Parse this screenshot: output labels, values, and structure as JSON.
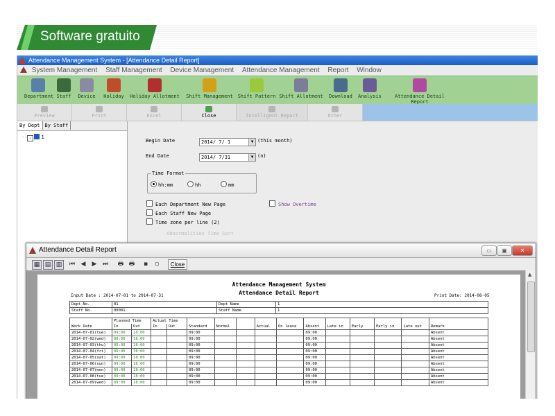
{
  "banner": {
    "label": "Software gratuito"
  },
  "window": {
    "title": "Attendance Management System - [Attendance Detail Report]"
  },
  "menu": [
    "System Management",
    "Staff Management",
    "Device Management",
    "Attendance Management",
    "Report",
    "Window"
  ],
  "toolbar": [
    "Department",
    "Staff",
    "Device",
    "Holiday",
    "Holiday Allotment",
    "Shift Management",
    "Shift Pattern",
    "Shift Allotment",
    "Download",
    "Analysis",
    "Attendance Detail Report"
  ],
  "subtoolbar": [
    "Preview",
    "Print",
    "Excel",
    "Close",
    "Intelligent Report",
    "Other"
  ],
  "left_tabs": [
    "By Dept",
    "By Staff"
  ],
  "tree": {
    "root": "1"
  },
  "form": {
    "begin_label": "Begin Date",
    "begin_value": "2014/ 7/ 1",
    "begin_note": "(this month)",
    "end_label": "End Date",
    "end_value": "2014/ 7/31",
    "end_note": "(n)",
    "time_format_legend": "Time Format",
    "opt1": "hh:mm",
    "opt2": "hh",
    "opt3": "mm",
    "check1": "Each Department New Page",
    "check2": "Each Staff New Page",
    "check3": "Time zone per line (2)",
    "show_overtime": "Show Overtime",
    "hidden_hint": "Abnormalities Time Sort"
  },
  "child": {
    "title": "Attendance Detail Report",
    "close": "Close"
  },
  "report": {
    "title1": "Attendance Management System",
    "title2": "Attendance Detail Report",
    "input_date": "Input Date : 2014-07-01 to 2014-07-31",
    "print_date": "Print Date: 2014-08-05",
    "dept_no_label": "Dept No.",
    "dept_no": "01",
    "dept_name_label": "Dept Name",
    "dept_name": "1",
    "staff_no_label": "Staff No.",
    "staff_no": "00001",
    "staff_name_label": "Staff Name",
    "staff_name": "1",
    "h_work_date": "Work Date",
    "h_planned": "Planned Time",
    "h_actual": "Actual Time",
    "h_in": "In",
    "h_out": "Out",
    "h_in2": "In",
    "h_out2": "Out",
    "h_standard": "Standard",
    "h_normal": "Normal",
    "h_actual2": "Actual",
    "h_onleave": "On leave",
    "h_absent": "Absent",
    "h_latein": "Late in",
    "h_early": "Early",
    "h_earlyin": "Early in",
    "h_lateout": "Late out",
    "h_remark": "Remark",
    "rows": [
      {
        "date": "2014-07-01(tue)",
        "in": "09:00",
        "out": "18:00",
        "std": "09:00",
        "abs": "09:00",
        "remark": "Absent"
      },
      {
        "date": "2014-07-02(wed)",
        "in": "09:00",
        "out": "18:00",
        "std": "09:00",
        "abs": "09:00",
        "remark": "Absent"
      },
      {
        "date": "2014-07-03(thu)",
        "in": "09:00",
        "out": "18:00",
        "std": "09:00",
        "abs": "09:00",
        "remark": "Absent"
      },
      {
        "date": "2014-07-04(fri)",
        "in": "09:00",
        "out": "18:00",
        "std": "09:00",
        "abs": "09:00",
        "remark": "Absent"
      },
      {
        "date": "2014-07-05(sat)",
        "in": "09:00",
        "out": "18:00",
        "std": "09:00",
        "abs": "09:00",
        "remark": "Absent"
      },
      {
        "date": "2014-07-06(sun)",
        "in": "09:00",
        "out": "18:00",
        "std": "09:00",
        "abs": "09:00",
        "remark": "Absent"
      },
      {
        "date": "2014-07-07(mon)",
        "in": "09:00",
        "out": "18:00",
        "std": "09:00",
        "abs": "09:00",
        "remark": "Absent"
      },
      {
        "date": "2014-07-08(tue)",
        "in": "09:00",
        "out": "18:00",
        "std": "09:00",
        "abs": "09:00",
        "remark": "Absent"
      },
      {
        "date": "2014-07-09(wed)",
        "in": "09:00",
        "out": "18:00",
        "std": "09:00",
        "abs": "09:00",
        "remark": "Absent"
      }
    ]
  }
}
